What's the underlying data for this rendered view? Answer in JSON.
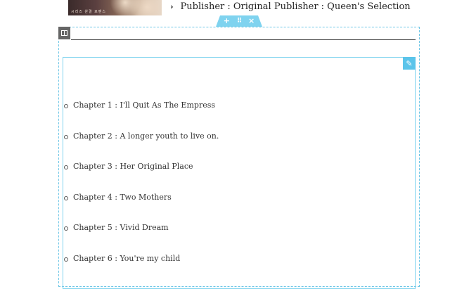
{
  "cover": {
    "thumbnail_text": "시리즈 완결 로맨스"
  },
  "publisher": {
    "chevron_icon": "chevron-right-icon",
    "text": "Publisher : Original Publisher : Queen's Selection"
  },
  "editor_toolbar": {
    "add_label": "+",
    "move_label": "⠿",
    "close_label": "×"
  },
  "accent_color": "#6ec6e6",
  "chapters": [
    {
      "label": "Chapter 1 : I'll Quit As The Empress"
    },
    {
      "label": "Chapter 2 : A longer youth to live on."
    },
    {
      "label": "Chapter 3 : Her Original Place"
    },
    {
      "label": "Chapter 4 : Two Mothers"
    },
    {
      "label": "Chapter 5 : Vivid Dream"
    },
    {
      "label": "Chapter 6 : You're my child"
    }
  ]
}
